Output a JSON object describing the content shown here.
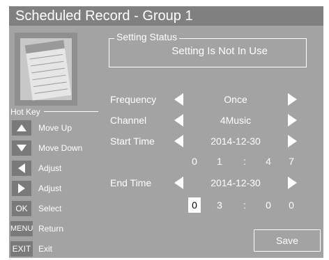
{
  "title": "Scheduled Record - Group 1",
  "hotkey": {
    "label": "Hot Key",
    "items": [
      {
        "key": "",
        "icon": "up-arrow-icon",
        "label": "Move Up"
      },
      {
        "key": "",
        "icon": "down-arrow-icon",
        "label": "Move Down"
      },
      {
        "key": "",
        "icon": "left-arrow-icon",
        "label": "Adjust"
      },
      {
        "key": "",
        "icon": "right-arrow-icon",
        "label": "Adjust"
      },
      {
        "key": "OK",
        "label": "Select"
      },
      {
        "key": "MENU",
        "label": "Return"
      },
      {
        "key": "EXIT",
        "label": "Exit"
      }
    ]
  },
  "status": {
    "legend": "Setting Status",
    "text": "Setting Is Not In Use"
  },
  "fields": {
    "frequency": {
      "label": "Frequency",
      "value": "Once"
    },
    "channel": {
      "label": "Channel",
      "value": "4Music"
    },
    "start_time": {
      "label": "Start Time",
      "date": "2014-12-30",
      "time_digits": [
        "0",
        "1",
        ":",
        "4",
        "7"
      ]
    },
    "end_time": {
      "label": "End Time",
      "date": "2014-12-30",
      "time_digits": [
        "0",
        "3",
        ":",
        "0",
        "0"
      ]
    }
  },
  "save_label": "Save",
  "colors": {
    "panel": "#a3a3a3",
    "titlebar": "#808080",
    "key_bg": "#7a7a7a",
    "text": "#ffffff"
  }
}
